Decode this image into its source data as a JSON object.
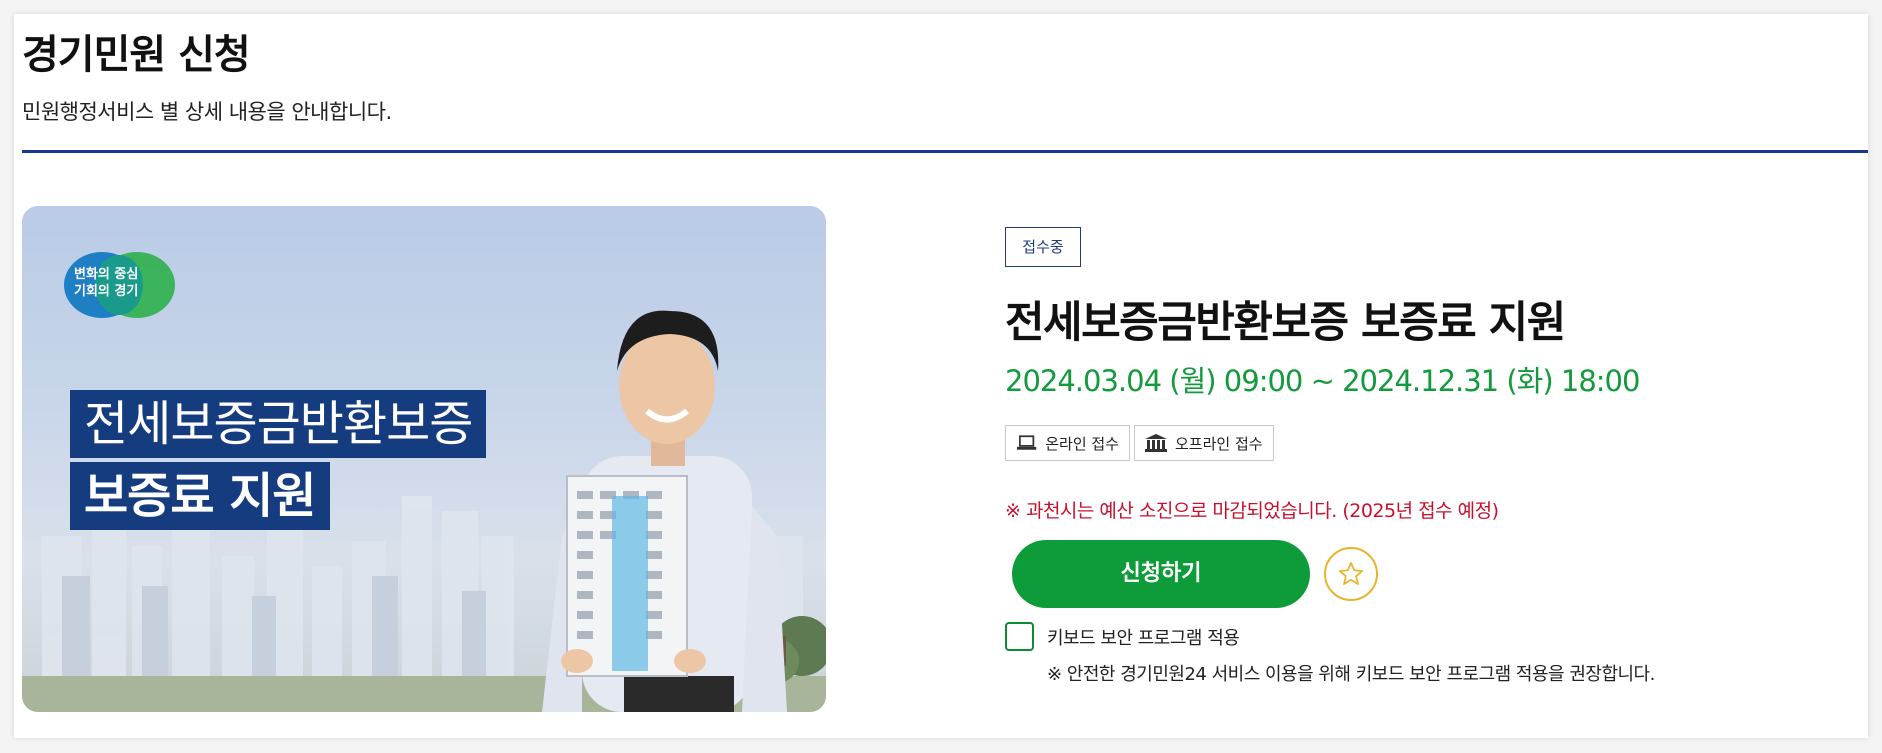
{
  "header": {
    "title": "경기민원 신청",
    "subtitle": "민원행정서비스 별 상세 내용을 안내합니다."
  },
  "banner": {
    "logo_line1": "변화의 중심",
    "logo_line2": "기회의 경기",
    "headline_line1": "전세보증금반환보증",
    "headline_line2": "보증료 지원"
  },
  "service": {
    "status": "접수중",
    "title": "전세보증금반환보증 보증료 지원",
    "period": "2024.03.04 (월) 09:00 ~ 2024.12.31 (화) 18:00",
    "methods": [
      {
        "label": "온라인 접수",
        "icon": "laptop-icon"
      },
      {
        "label": "오프라인 접수",
        "icon": "building-icon"
      }
    ],
    "notice": "※ 과천시는 예산 소진으로 마감되었습니다. (2025년 접수 예정)",
    "apply_label": "신청하기",
    "keyboard_label": "키보드 보안 프로그램 적용",
    "keyboard_note": "※ 안전한 경기민원24 서비스 이용을 위해 키보드 보안 프로그램 적용을 권장합니다."
  },
  "colors": {
    "accent": "#0e9b3a",
    "divider": "#163a8a",
    "notice": "#c8102e",
    "favorite": "#e8b52a"
  }
}
